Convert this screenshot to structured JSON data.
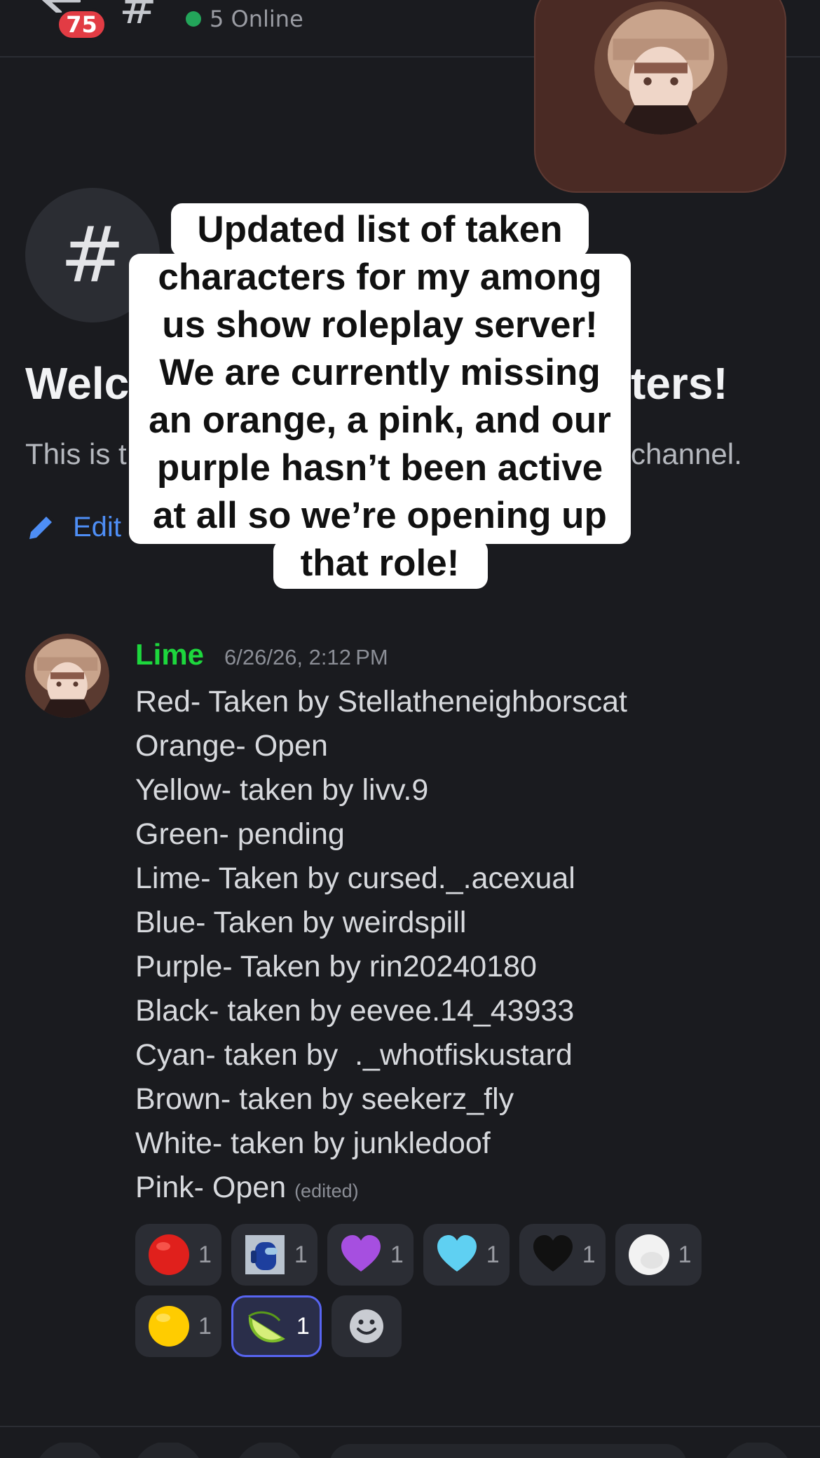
{
  "header": {
    "notification_count": "75",
    "online_text": "5 Online"
  },
  "intro": {
    "welcome_left": "Welc",
    "welcome_right": "ters!",
    "desc_left": "This is t",
    "desc_right": "channel.",
    "edit_label": "Edit"
  },
  "caption": {
    "lines": [
      "Updated list of taken",
      "characters for my among",
      "us show roleplay server!",
      "We are currently missing",
      "an orange, a pink, and our",
      "purple hasn’t been active",
      "at all so we’re opening up",
      "that role!"
    ]
  },
  "message": {
    "author": "Lime",
    "author_color": "#1dd73d",
    "timestamp": "6/26/26, 2:12 PM",
    "lines": [
      "Red- Taken by Stellatheneighborscat",
      "Orange- Open",
      "Yellow- taken by livv.9",
      "Green- pending",
      "Lime- Taken by cursed._.acexual",
      "Blue- Taken by weirdspill",
      "Purple- Taken by rin20240180",
      "Black- taken by eevee.14_43933",
      "Cyan- taken by  ._whotfiskustard",
      "Brown- taken by seekerz_fly",
      "White- taken by junkledoof",
      "Pink- Open"
    ],
    "edited_label": "(edited)"
  },
  "reactions": [
    {
      "emoji": "red-circle-emoji",
      "count": "1",
      "active": false
    },
    {
      "emoji": "among-us-blue-emoji",
      "count": "1",
      "active": false
    },
    {
      "emoji": "purple-heart-emoji",
      "count": "1",
      "active": false
    },
    {
      "emoji": "light-blue-heart-emoji",
      "count": "1",
      "active": false
    },
    {
      "emoji": "black-heart-emoji",
      "count": "1",
      "active": false
    },
    {
      "emoji": "white-circle-emoji",
      "count": "1",
      "active": false
    },
    {
      "emoji": "yellow-circle-emoji",
      "count": "1",
      "active": false
    },
    {
      "emoji": "lime-emoji",
      "count": "1",
      "active": true
    }
  ]
}
